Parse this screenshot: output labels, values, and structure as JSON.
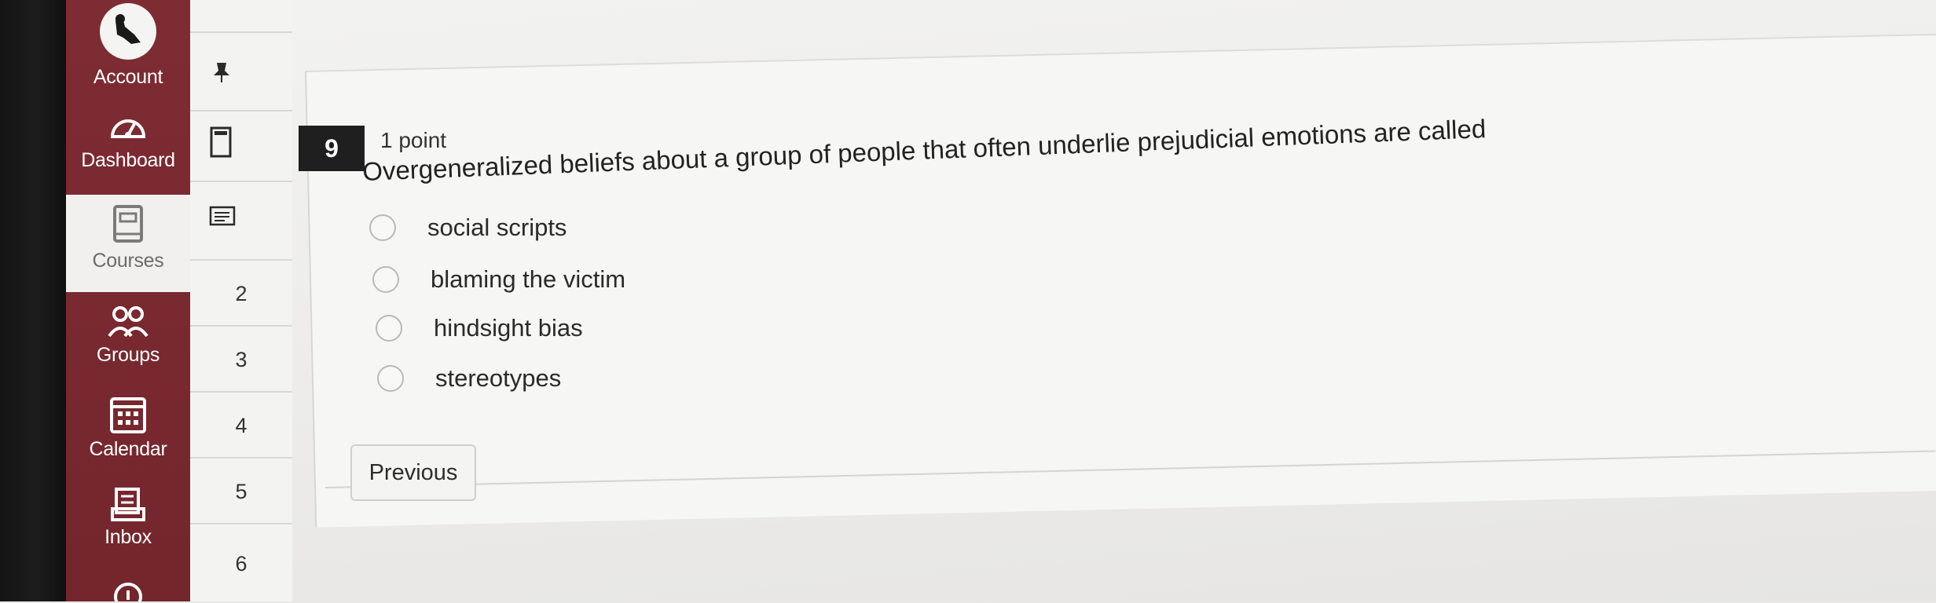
{
  "global_nav": {
    "items": [
      {
        "label": "Account",
        "icon": "user-avatar"
      },
      {
        "label": "Dashboard",
        "icon": "speedometer-icon"
      },
      {
        "label": "Courses",
        "icon": "book-icon"
      },
      {
        "label": "Groups",
        "icon": "groups-icon"
      },
      {
        "label": "Calendar",
        "icon": "calendar-icon"
      },
      {
        "label": "Inbox",
        "icon": "inbox-icon"
      }
    ]
  },
  "question_nav": {
    "numbers": [
      "2",
      "3",
      "4",
      "5",
      "6"
    ]
  },
  "question": {
    "number": "9",
    "points": "1 point",
    "text": "Overgeneralized beliefs about a group of people that often underlie prejudicial emotions are called",
    "options": [
      "social scripts",
      "blaming the victim",
      "hindsight bias",
      "stereotypes"
    ]
  },
  "buttons": {
    "previous": "Previous"
  },
  "colors": {
    "nav_background": "#7e2c33",
    "question_badge": "#1f1f1f"
  }
}
